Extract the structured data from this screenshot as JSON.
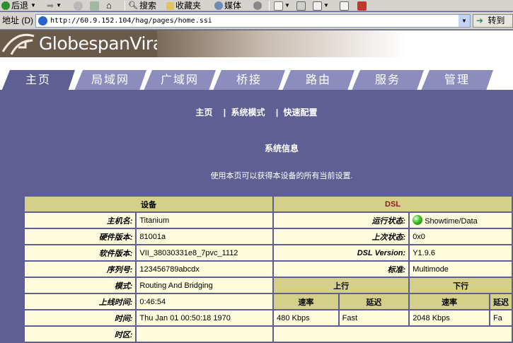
{
  "browser": {
    "back_label": "后退",
    "search_label": "搜索",
    "favorites_label": "收藏夹",
    "media_label": "媒体",
    "address_label": "地址 (D)",
    "url": "http://60.9.152.104/hag/pages/home.ssi",
    "go_label": "转到"
  },
  "banner": {
    "logo_text": "GlobespanVirata"
  },
  "tabs": [
    {
      "label": "主页",
      "active": true
    },
    {
      "label": "局域网"
    },
    {
      "label": "广域网"
    },
    {
      "label": "桥接"
    },
    {
      "label": "路由"
    },
    {
      "label": "服务"
    },
    {
      "label": "管理"
    }
  ],
  "quicklinks": [
    {
      "label": "主页"
    },
    {
      "label": "系统模式"
    },
    {
      "label": "快速配置"
    }
  ],
  "quicklinks_sep": "|",
  "section": {
    "title": "系统信息",
    "description": "使用本页可以获得本设备的所有当前设置."
  },
  "device": {
    "header": "设备",
    "rows": [
      {
        "label": "主机名:",
        "value": "Titanium"
      },
      {
        "label": "硬件版本:",
        "value": "81001a"
      },
      {
        "label": "软件版本:",
        "value": "VII_38030331e8_7pvc_1112"
      },
      {
        "label": "序列号:",
        "value": "123456789abcdx"
      },
      {
        "label": "模式:",
        "value": "Routing And Bridging"
      },
      {
        "label": "上线时间:",
        "value": "0:46:54"
      },
      {
        "label": "时间:",
        "value": "Thu Jan 01 00:50:18 1970"
      },
      {
        "label": "时区:",
        "value": ""
      }
    ]
  },
  "dsl": {
    "header": "DSL",
    "status_color": "#3fbf2a",
    "rows": [
      {
        "label": "运行状态:",
        "value": "Showtime/Data"
      },
      {
        "label": "上次状态:",
        "value": "0x0"
      },
      {
        "label": "DSL Version:",
        "value": "Y1.9.6"
      },
      {
        "label": "标准:",
        "value": "Multimode"
      }
    ],
    "upstream_label": "上行",
    "downstream_label": "下行",
    "rate_label": "速率",
    "latency_label": "延迟",
    "upstream_rate": "480 Kbps",
    "upstream_latency": "Fast",
    "downstream_rate": "2048 Kbps",
    "downstream_latency": "Fa"
  }
}
